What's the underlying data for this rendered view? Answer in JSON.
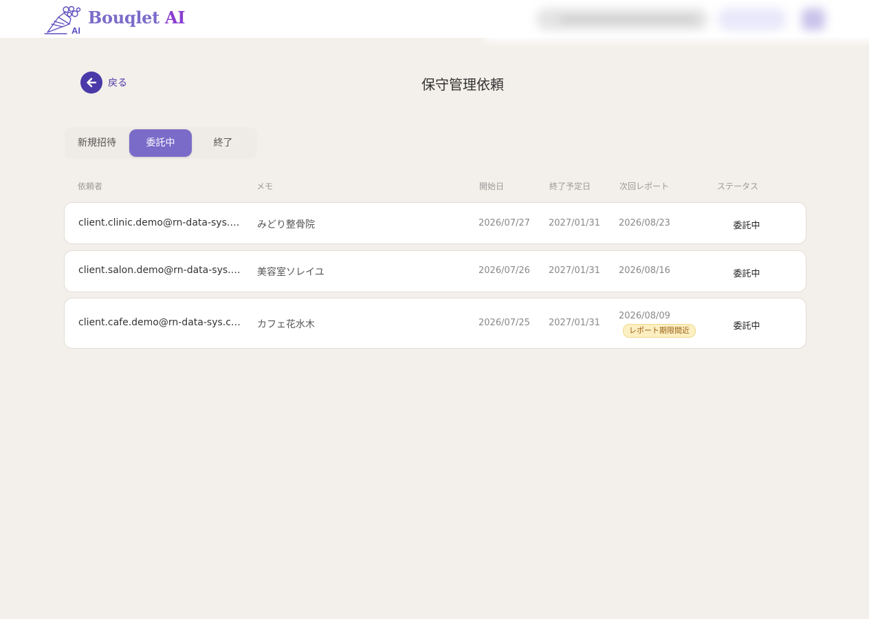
{
  "header": {
    "brand_main": "Bouqlet",
    "brand_ai": "AI",
    "logo_badge": "AI",
    "colors": {
      "brand": "#7b6bc9",
      "brand_ai": "#8a3ed0",
      "accent": "#4a39a8",
      "background": "#f3efea"
    }
  },
  "nav": {
    "back_label": "戻る",
    "back_icon": "arrow-left-icon"
  },
  "page": {
    "title": "保守管理依頼"
  },
  "tabs": [
    {
      "label": "新規招待",
      "active": false
    },
    {
      "label": "委託中",
      "active": true
    },
    {
      "label": "終了",
      "active": false
    }
  ],
  "table": {
    "columns": [
      "依頼者",
      "メモ",
      "開始日",
      "終了予定日",
      "次回レポート",
      "ステータス"
    ],
    "rows": [
      {
        "requester": "client.clinic.demo@rn-data-sys.com",
        "memo": "みどり整骨院",
        "start": "2026/07/27",
        "end": "2027/01/31",
        "next_report": "2026/08/23",
        "badge": "",
        "status": "委託中"
      },
      {
        "requester": "client.salon.demo@rn-data-sys.com",
        "memo": "美容室ソレイユ",
        "start": "2026/07/26",
        "end": "2027/01/31",
        "next_report": "2026/08/16",
        "badge": "",
        "status": "委託中"
      },
      {
        "requester": "client.cafe.demo@rn-data-sys.com.....",
        "memo": "カフェ花水木",
        "start": "2026/07/25",
        "end": "2027/01/31",
        "next_report": "2026/08/09",
        "badge": "レポート期限間近",
        "status": "委託中"
      }
    ]
  }
}
